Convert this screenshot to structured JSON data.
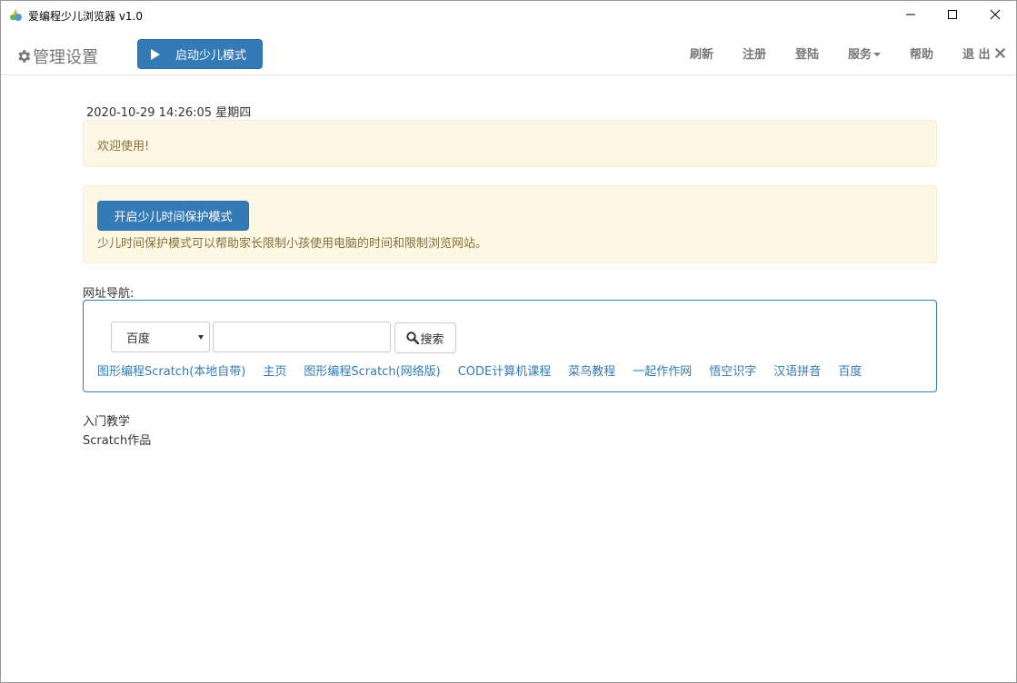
{
  "window": {
    "title": "爱编程少儿浏览器 v1.0"
  },
  "navbar": {
    "brand": "管理设置",
    "start_button": "启动少儿模式",
    "links": {
      "refresh": "刷新",
      "register": "注册",
      "login": "登陆",
      "service": "服务",
      "help": "帮助",
      "exit": "退 出"
    }
  },
  "content": {
    "datetime": "2020-10-29 14:26:05 星期四",
    "welcome": "欢迎使用!",
    "protect_button": "开启少儿时间保护模式",
    "protect_desc": "少儿时间保护模式可以帮助家长限制小孩使用电脑的时间和限制浏览网站。",
    "nav_title": "网址导航:",
    "search": {
      "engine": "百度",
      "value": "",
      "button": "搜索"
    },
    "links": [
      "图形编程Scratch(本地自带)",
      "主页",
      "图形编程Scratch(网络版)",
      "CODE计算机课程",
      "菜鸟教程",
      "一起作作网",
      "悟空识字",
      "汉语拼音",
      "百度"
    ],
    "sections": [
      "入门教学",
      "Scratch作品"
    ]
  },
  "colors": {
    "primary": "#337ab7",
    "warning_bg": "#fcf8e3",
    "warning_text": "#8a6d3b"
  }
}
